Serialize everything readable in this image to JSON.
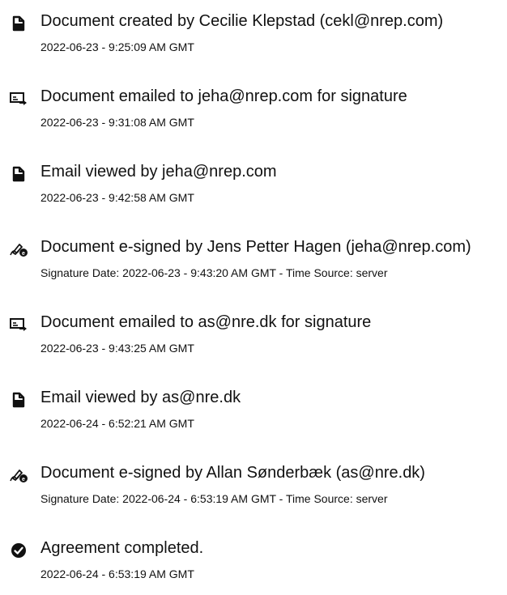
{
  "events": [
    {
      "icon": "document-icon",
      "title": "Document created by Cecilie Klepstad (cekl@nrep.com)",
      "meta": "2022-06-23 - 9:25:09 AM GMT"
    },
    {
      "icon": "email-send-icon",
      "title": "Document emailed to jeha@nrep.com for signature",
      "meta": "2022-06-23 - 9:31:08 AM GMT"
    },
    {
      "icon": "document-icon",
      "title": "Email viewed by jeha@nrep.com",
      "meta": "2022-06-23 - 9:42:58 AM GMT"
    },
    {
      "icon": "esign-pen-icon",
      "title": "Document e-signed by Jens Petter Hagen (jeha@nrep.com)",
      "meta": "Signature Date: 2022-06-23 - 9:43:20 AM GMT - Time Source: server"
    },
    {
      "icon": "email-send-icon",
      "title": "Document emailed to as@nre.dk for signature",
      "meta": "2022-06-23 - 9:43:25 AM GMT"
    },
    {
      "icon": "document-icon",
      "title": "Email viewed by as@nre.dk",
      "meta": "2022-06-24 - 6:52:21 AM GMT"
    },
    {
      "icon": "esign-pen-icon",
      "title": "Document e-signed by Allan Sønderbæk (as@nre.dk)",
      "meta": "Signature Date: 2022-06-24 - 6:53:19 AM GMT - Time Source: server"
    },
    {
      "icon": "check-circle-icon",
      "title": "Agreement completed.",
      "meta": "2022-06-24 - 6:53:19 AM GMT"
    }
  ]
}
